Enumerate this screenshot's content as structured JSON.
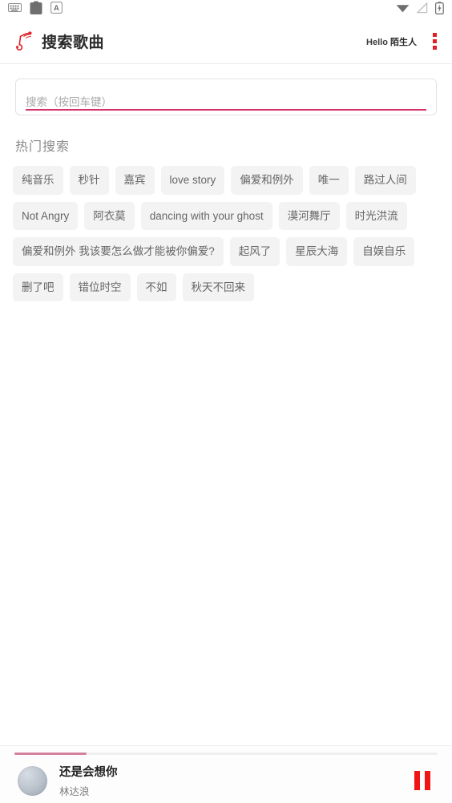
{
  "status_bar": {
    "left_icons": [
      "keyboard-icon",
      "clipboard-icon",
      "letter-a-icon"
    ],
    "right_icons": [
      "wifi-icon",
      "signal-off-icon",
      "battery-charging-icon"
    ]
  },
  "header": {
    "logo_icon": "music-note-logo-icon",
    "title": "搜索歌曲",
    "greeting_prefix": "Hello ",
    "username": "陌生人",
    "menu_icon": "kebab-menu-icon"
  },
  "search": {
    "value": "",
    "placeholder": "搜索（按回车键）",
    "accent_color": "#d6336c"
  },
  "hot_search": {
    "title": "热门搜索",
    "tags": [
      "纯音乐",
      "秒针",
      "嘉宾",
      "love story",
      "偏爱和例外",
      "唯一",
      "路过人间",
      "Not Angry",
      "阿衣莫",
      "dancing with your ghost",
      "漠河舞厅",
      "时光洪流",
      "偏爱和例外 我该要怎么做才能被你偏爱?",
      "起风了",
      "星辰大海",
      "自娱自乐",
      "删了吧",
      "错位时空",
      "不如",
      "秋天不回来"
    ]
  },
  "player": {
    "song_title": "还是会想你",
    "artist": "林达浪",
    "progress_percent": 17,
    "progress_color": "#d3819f",
    "pause_icon": "pause-icon",
    "pause_color": "#f11414",
    "album_art": "album-art-thumbnail"
  }
}
